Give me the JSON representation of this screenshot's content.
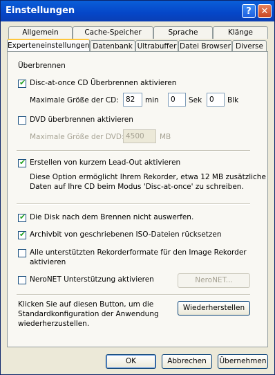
{
  "window": {
    "title": "Einstellungen",
    "help_glyph": "?",
    "close_glyph": "✕"
  },
  "tabs_row1": [
    "Allgemein",
    "Cache-Speicher",
    "Sprache",
    "Klänge"
  ],
  "tabs_row2": [
    "Experteneinstellungen",
    "Datenbank",
    "Ultrabuffer",
    "Datei Browser",
    "Diverse"
  ],
  "panel": {
    "section_title": "Überbrennen",
    "cd_overburn": {
      "label": "Disc-at-once CD Überbrennen aktivieren",
      "checked": true
    },
    "cd_size": {
      "label": "Maximale Größe der CD:",
      "min_value": "82",
      "min_unit": "min",
      "sec_value": "0",
      "sec_unit": "Sek",
      "blk_value": "0",
      "blk_unit": "Blk"
    },
    "dvd_overburn": {
      "label": "DVD überbrennen aktivieren",
      "checked": false
    },
    "dvd_size": {
      "label": "Maximale Größe der DVD:",
      "value": "4500",
      "unit": "MB"
    },
    "leadout": {
      "label": "Erstellen von kurzem Lead-Out aktivieren",
      "checked": true,
      "description_line1": "Diese Option ermöglicht Ihrem Rekorder, etwa 12 MB zusätzliche",
      "description_line2": "Daten auf Ihre CD beim Modus 'Disc-at-once' zu schreiben."
    },
    "no_eject": {
      "label": "Die Disk nach dem Brennen nicht auswerfen.",
      "checked": true
    },
    "archive_bit": {
      "label": "Archivbit von geschriebenen ISO-Dateien rücksetzen",
      "checked": true
    },
    "all_formats": {
      "label_line1": "Alle unterstützten Rekorderformate für den Image Rekorder",
      "label_line2": "aktivieren",
      "checked": false
    },
    "neronet": {
      "label": "NeroNET Unterstützung aktivieren",
      "checked": false,
      "button": "NeroNET..."
    },
    "restore": {
      "text_line1": "Klicken Sie auf diesen Button, um die",
      "text_line2": "Standardkonfiguration der Anwendung",
      "text_line3": "wiederherzustellen.",
      "button": "Wiederherstellen"
    }
  },
  "footer": {
    "ok": "OK",
    "cancel": "Abbrechen",
    "apply": "Übernehmen"
  },
  "check_glyph": "✔"
}
